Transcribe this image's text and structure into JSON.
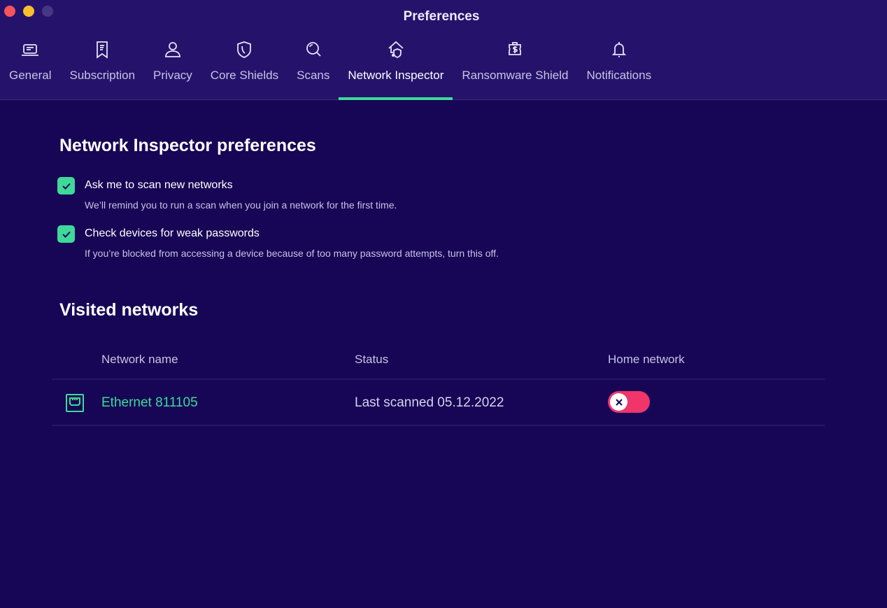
{
  "window": {
    "title": "Preferences",
    "controls": [
      "close",
      "minimize",
      "zoom"
    ]
  },
  "tabs": [
    {
      "label": "General",
      "icon": "laptop-icon",
      "active": false
    },
    {
      "label": "Subscription",
      "icon": "receipt-bookmark-icon",
      "active": false
    },
    {
      "label": "Privacy",
      "icon": "user-icon",
      "active": false
    },
    {
      "label": "Core Shields",
      "icon": "shield-icon",
      "active": false
    },
    {
      "label": "Scans",
      "icon": "search-icon",
      "active": false
    },
    {
      "label": "Network Inspector",
      "icon": "home-network-shield-icon",
      "active": true
    },
    {
      "label": "Ransomware Shield",
      "icon": "ransomware-dollar-icon",
      "active": false
    },
    {
      "label": "Notifications",
      "icon": "bell-icon",
      "active": false
    }
  ],
  "preferences": {
    "title": "Network Inspector preferences",
    "options": [
      {
        "label": "Ask me to scan new networks",
        "description": "We’ll remind you to run a scan when you join a network for the first time.",
        "checked": true
      },
      {
        "label": "Check devices for weak passwords",
        "description": "If you’re blocked from accessing a device because of too many password attempts, turn this off.",
        "checked": true
      }
    ]
  },
  "visited": {
    "title": "Visited networks",
    "columns": [
      "Network name",
      "Status",
      "Home network"
    ],
    "rows": [
      {
        "icon": "ethernet-icon",
        "name": "Ethernet 811105",
        "status": "Last scanned 05.12.2022",
        "home_network": false
      }
    ]
  },
  "colors": {
    "accent": "#3ed99a",
    "toggle_off": "#f0356b",
    "header_bg": "#25136b",
    "body_bg": "#170655"
  }
}
